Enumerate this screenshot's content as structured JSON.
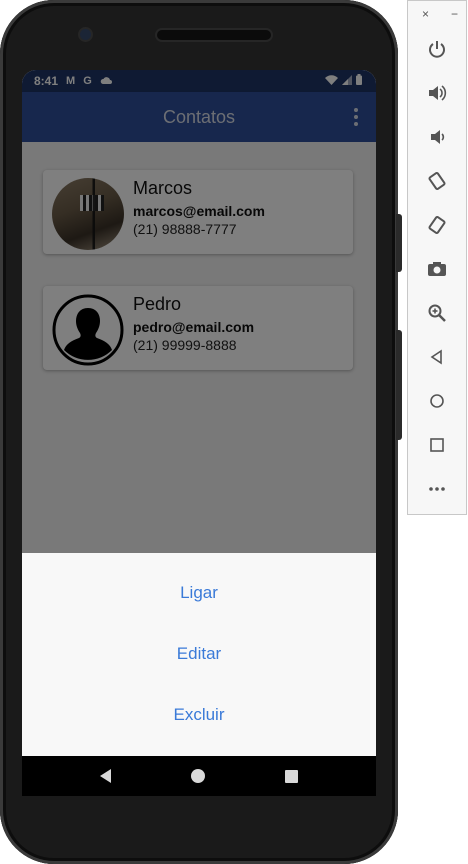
{
  "status_bar": {
    "time": "8:41",
    "notification_icons": [
      "gmail-icon",
      "google-icon",
      "cloud-icon"
    ],
    "system_icons": [
      "wifi-icon",
      "signal-icon",
      "battery-icon"
    ]
  },
  "app_bar": {
    "title": "Contatos",
    "menu_icon": "overflow-menu-icon"
  },
  "contacts": [
    {
      "name": "Marcos",
      "email": "marcos@email.com",
      "phone": "(21) 98888-7777",
      "avatar": "photo"
    },
    {
      "name": "Pedro",
      "email": "pedro@email.com",
      "phone": "(21) 99999-8888",
      "avatar": "person-silhouette-icon"
    }
  ],
  "bottom_sheet": {
    "actions": [
      "Ligar",
      "Editar",
      "Excluir"
    ]
  },
  "nav_bar": [
    "back-icon",
    "home-icon",
    "recents-icon"
  ],
  "emulator_toolbar": {
    "window_controls": [
      "×",
      "−"
    ],
    "buttons": [
      "power-icon",
      "volume-up-icon",
      "volume-down-icon",
      "rotate-left-icon",
      "rotate-right-icon",
      "camera-icon",
      "zoom-icon",
      "back-icon",
      "home-icon",
      "overview-icon",
      "more-icon"
    ]
  },
  "colors": {
    "status_bar": "#1e3466",
    "app_bar": "#2e4f9a",
    "action_text": "#3a7ad8",
    "sheet_bg": "#f8f8f8"
  }
}
